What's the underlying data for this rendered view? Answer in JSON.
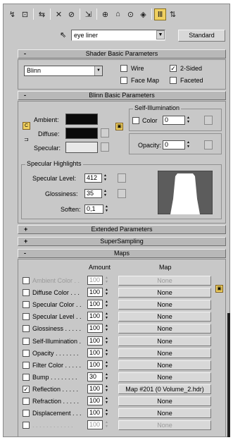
{
  "toolbar": {
    "icons": [
      "get-material-icon",
      "put-to-scene-icon",
      "assign-material-icon",
      "reset-map-icon",
      "delete-icon",
      "make-unique-icon",
      "put-to-library-icon",
      "material-effects-channel-icon",
      "show-map-icon",
      "show-end-result-icon",
      "go-to-parent-icon",
      "go-forward-sibling-icon"
    ],
    "glyphs": [
      "↯",
      "⊡",
      "⇆",
      "✕",
      "⊘",
      "⇲",
      "⊕",
      "⌂",
      "⊙",
      "◈",
      "Ⅲ",
      "⇅"
    ]
  },
  "material": {
    "name": "eye liner",
    "type_button": "Standard"
  },
  "shader_basic": {
    "title": "Shader Basic Parameters",
    "sign": "-",
    "shader": "Blinn",
    "wire_label": "Wire",
    "two_sided_label": "2-Sided",
    "face_map_label": "Face Map",
    "faceted_label": "Faceted",
    "two_sided_check": "✓"
  },
  "blinn_basic": {
    "title": "Blinn Basic Parameters",
    "sign": "-",
    "ambient_label": "Ambient:",
    "diffuse_label": "Diffuse:",
    "specular_label": "Specular:",
    "lock_glyph_left": "C",
    "self_illum_title": "Self-Illumination",
    "color_label": "Color",
    "color_value": "0",
    "opacity_label": "Opacity:",
    "opacity_value": "0",
    "spec_title": "Specular Highlights",
    "spec_level_label": "Specular Level:",
    "spec_level_value": "412",
    "gloss_label": "Glossiness:",
    "gloss_value": "35",
    "soften_label": "Soften:",
    "soften_value": "0,1",
    "colors": {
      "ambient": "#0a0a0a",
      "diffuse": "#0a0a0a",
      "specular": "#e8e8e8"
    }
  },
  "extended": {
    "title": "Extended Parameters",
    "sign": "+"
  },
  "supersampling": {
    "title": "SuperSampling",
    "sign": "+"
  },
  "maps": {
    "title": "Maps",
    "sign": "-",
    "amount_header": "Amount",
    "map_header": "Map",
    "rows": [
      {
        "label": "Ambient Color . .",
        "amount": "100",
        "map": "None",
        "checked": "",
        "dim": true
      },
      {
        "label": "Diffuse Color . . .",
        "amount": "100",
        "map": "None",
        "checked": "",
        "dim": false
      },
      {
        "label": "Specular Color . .",
        "amount": "100",
        "map": "None",
        "checked": "",
        "dim": false
      },
      {
        "label": "Specular Level . .",
        "amount": "100",
        "map": "None",
        "checked": "",
        "dim": false
      },
      {
        "label": "Glossiness . . . . .",
        "amount": "100",
        "map": "None",
        "checked": "",
        "dim": false
      },
      {
        "label": "Self-Illumination .",
        "amount": "100",
        "map": "None",
        "checked": "",
        "dim": false
      },
      {
        "label": "Opacity . . . . . . .",
        "amount": "100",
        "map": "None",
        "checked": "",
        "dim": false
      },
      {
        "label": "Filter Color . . . . .",
        "amount": "100",
        "map": "None",
        "checked": "",
        "dim": false
      },
      {
        "label": "Bump . . . . . . . .",
        "amount": "30",
        "map": "None",
        "checked": "",
        "dim": false
      },
      {
        "label": "Reflection . . . . .",
        "amount": "100",
        "map": "Map #201 (0 Volume_2.hdr)",
        "checked": "✓",
        "dim": false
      },
      {
        "label": "Refraction . . . . .",
        "amount": "100",
        "map": "None",
        "checked": "",
        "dim": false
      },
      {
        "label": "Displacement . . .",
        "amount": "100",
        "map": "None",
        "checked": "",
        "dim": false
      },
      {
        "label": ". . . . . . . . . . . .",
        "amount": "100",
        "map": "None",
        "checked": "",
        "dim": true
      }
    ]
  }
}
